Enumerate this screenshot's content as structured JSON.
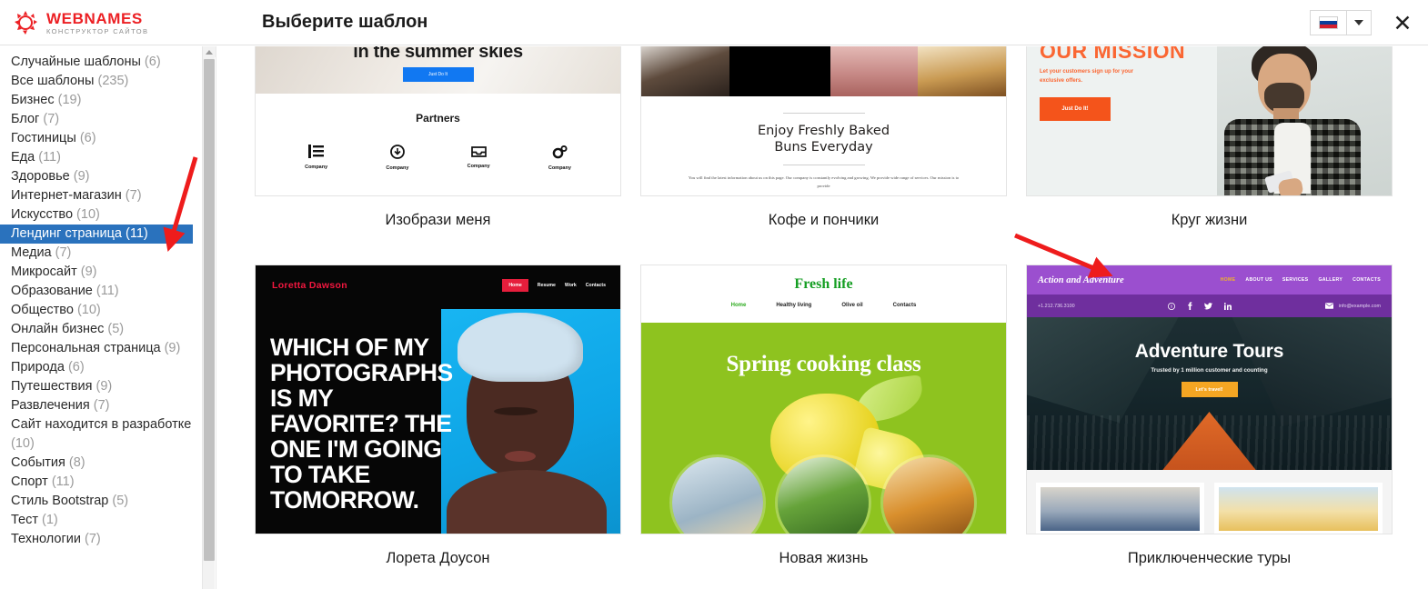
{
  "header": {
    "logo_name": "WEBNAMES",
    "logo_sub": "КОНСТРУКТОР САЙТОВ",
    "title": "Выберите шаблон",
    "lang_flag_icon": "russian-flag-icon",
    "lang_caret_icon": "chevron-down-icon",
    "close_icon": "✕"
  },
  "sidebar": {
    "categories": [
      {
        "label": "Случайные шаблоны",
        "count": "(6)",
        "selected": false,
        "wrap": false
      },
      {
        "label": "Все шаблоны",
        "count": "(235)",
        "selected": false,
        "wrap": false
      },
      {
        "label": "Бизнес",
        "count": "(19)",
        "selected": false,
        "wrap": false
      },
      {
        "label": "Блог",
        "count": "(7)",
        "selected": false,
        "wrap": false
      },
      {
        "label": "Гостиницы",
        "count": "(6)",
        "selected": false,
        "wrap": false
      },
      {
        "label": "Еда",
        "count": "(11)",
        "selected": false,
        "wrap": false
      },
      {
        "label": "Здоровье",
        "count": "(9)",
        "selected": false,
        "wrap": false
      },
      {
        "label": "Интернет-магазин",
        "count": "(7)",
        "selected": false,
        "wrap": false
      },
      {
        "label": "Искусство",
        "count": "(10)",
        "selected": false,
        "wrap": false
      },
      {
        "label": "Лендинг страница (11)",
        "count": "",
        "selected": true,
        "wrap": false
      },
      {
        "label": "Медиа",
        "count": "(7)",
        "selected": false,
        "wrap": false
      },
      {
        "label": "Микросайт",
        "count": "(9)",
        "selected": false,
        "wrap": false
      },
      {
        "label": "Образование",
        "count": "(11)",
        "selected": false,
        "wrap": false
      },
      {
        "label": "Общество",
        "count": "(10)",
        "selected": false,
        "wrap": false
      },
      {
        "label": "Онлайн бизнес",
        "count": "(5)",
        "selected": false,
        "wrap": false
      },
      {
        "label": "Персональная страница",
        "count": "(9)",
        "selected": false,
        "wrap": false
      },
      {
        "label": "Природа",
        "count": "(6)",
        "selected": false,
        "wrap": false
      },
      {
        "label": "Путешествия",
        "count": "(9)",
        "selected": false,
        "wrap": false
      },
      {
        "label": "Развлечения",
        "count": "(7)",
        "selected": false,
        "wrap": false
      },
      {
        "label": "Сайт находится в разработке",
        "count": "(10)",
        "selected": false,
        "wrap": true
      },
      {
        "label": "События",
        "count": "(8)",
        "selected": false,
        "wrap": false
      },
      {
        "label": "Спорт",
        "count": "(11)",
        "selected": false,
        "wrap": false
      },
      {
        "label": "Стиль Bootstrap",
        "count": "(5)",
        "selected": false,
        "wrap": false
      },
      {
        "label": "Тест",
        "count": "(1)",
        "selected": false,
        "wrap": false
      },
      {
        "label": "Технологии",
        "count": "(7)",
        "selected": false,
        "wrap": false
      }
    ],
    "scrollbar_up_icon": "scroll-up-arrow-icon"
  },
  "templates": {
    "row1": [
      {
        "title": "Изобрази меня",
        "hero_heading": "in the summer skies",
        "hero_button": "Just Do It",
        "section_heading": "Partners",
        "partner_labels": [
          "Company",
          "Company",
          "Company",
          "Company"
        ]
      },
      {
        "title": "Кофе и пончики",
        "heading_line1": "Enjoy Freshly Baked",
        "heading_line2": "Buns Everyday",
        "paragraph": "You will find the latest information about us on this page. Our company is constantly evolving and growing. We provide wide range of services. Our mission is to provide"
      },
      {
        "title": "Круг жизни",
        "heading": "OUR MISSION",
        "subtext": "Let your customers sign up for your exclusive offers.",
        "button": "Just Do It!"
      }
    ],
    "row2": [
      {
        "title": "Лорета Доусон",
        "brand": "Loretta Dawson",
        "nav": [
          "Home",
          "Resume",
          "Work",
          "Contacts"
        ],
        "headline": "WHICH OF MY PHOTOGRAPHS IS MY FAVORITE? THE ONE I'M GOING TO TAKE TOMORROW."
      },
      {
        "title": "Новая жизнь",
        "brand": "Fresh life",
        "nav": [
          "Home",
          "Healthy living",
          "Olive oil",
          "Contacts"
        ],
        "headline": "Spring cooking class"
      },
      {
        "title": "Приключенческие туры",
        "brand": "Action and Adventure",
        "nav": [
          "HOME",
          "ABOUT US",
          "SERVICES",
          "GALLERY",
          "CONTACTS"
        ],
        "phone": "+1.212.736.3100",
        "email": "info@example.com",
        "social": [
          "pinterest-icon",
          "facebook-icon",
          "twitter-icon",
          "linkedin-icon"
        ],
        "headline": "Adventure Tours",
        "subtext": "Trusted by 1 million customer and counting",
        "button": "Let's travel!"
      }
    ]
  },
  "annotations": {
    "arrow1_target": "Лендинг страница (11)",
    "arrow2_target": "Приключенческие туры",
    "arrow_color": "#ee1c1c"
  }
}
